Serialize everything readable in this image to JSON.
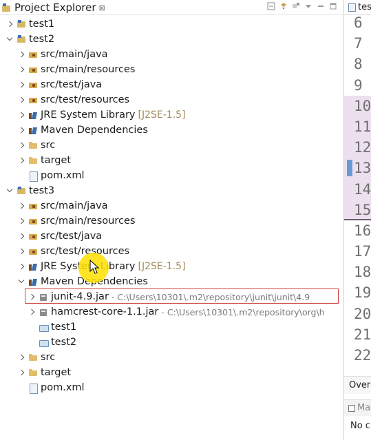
{
  "explorer": {
    "title": "Project Explorer",
    "close_glyph": "⊠",
    "toolbar_icons": [
      "collapse-all-icon",
      "link-editor-icon",
      "focus-icon",
      "view-menu-icon",
      "minimize-icon",
      "maximize-icon"
    ]
  },
  "tree": [
    {
      "level": 0,
      "expand": "right",
      "icon": "project",
      "label": "test1"
    },
    {
      "level": 0,
      "expand": "down",
      "icon": "project",
      "label": "test2"
    },
    {
      "level": 1,
      "expand": "right",
      "icon": "srcfolder",
      "label": "src/main/java"
    },
    {
      "level": 1,
      "expand": "right",
      "icon": "srcfolder",
      "label": "src/main/resources"
    },
    {
      "level": 1,
      "expand": "right",
      "icon": "srcfolder",
      "label": "src/test/java"
    },
    {
      "level": 1,
      "expand": "right",
      "icon": "srcfolder",
      "label": "src/test/resources"
    },
    {
      "level": 1,
      "expand": "right",
      "icon": "library",
      "label": "JRE System Library",
      "deco": "[J2SE-1.5]"
    },
    {
      "level": 1,
      "expand": "right",
      "icon": "library",
      "label": "Maven Dependencies"
    },
    {
      "level": 1,
      "expand": "right",
      "icon": "folder",
      "label": "src"
    },
    {
      "level": 1,
      "expand": "right",
      "icon": "folder",
      "label": "target"
    },
    {
      "level": 1,
      "expand": "none",
      "icon": "xml",
      "label": "pom.xml"
    },
    {
      "level": 0,
      "expand": "down",
      "icon": "project",
      "label": "test3"
    },
    {
      "level": 1,
      "expand": "right",
      "icon": "srcfolder",
      "label": "src/main/java"
    },
    {
      "level": 1,
      "expand": "right",
      "icon": "srcfolder",
      "label": "src/main/resources"
    },
    {
      "level": 1,
      "expand": "right",
      "icon": "srcfolder",
      "label": "src/test/java"
    },
    {
      "level": 1,
      "expand": "right",
      "icon": "srcfolder",
      "label": "src/test/resources"
    },
    {
      "level": 1,
      "expand": "right",
      "icon": "library",
      "label": "JRE System Library",
      "deco": "[J2SE-1.5]"
    },
    {
      "level": 1,
      "expand": "down",
      "icon": "library",
      "label": "Maven Dependencies"
    },
    {
      "level": 2,
      "expand": "right",
      "icon": "jar",
      "label": "junit-4.9.jar",
      "path": "- C:\\Users\\10301\\.m2\\repository\\junit\\junit\\4.9",
      "selected": true
    },
    {
      "level": 2,
      "expand": "right",
      "icon": "jar",
      "label": "hamcrest-core-1.1.jar",
      "path": "- C:\\Users\\10301\\.m2\\repository\\org\\h"
    },
    {
      "level": 2,
      "expand": "none",
      "icon": "folder-blue",
      "label": "test1"
    },
    {
      "level": 2,
      "expand": "none",
      "icon": "folder-blue",
      "label": "test2"
    },
    {
      "level": 1,
      "expand": "right",
      "icon": "folder",
      "label": "src"
    },
    {
      "level": 1,
      "expand": "right",
      "icon": "folder",
      "label": "target"
    },
    {
      "level": 1,
      "expand": "none",
      "icon": "xml",
      "label": "pom.xml"
    }
  ],
  "editor": {
    "tab_label": "tes",
    "line_numbers": [
      "6",
      "7",
      "8",
      "9",
      "10",
      "11",
      "12",
      "13",
      "14",
      "15",
      "16",
      "17",
      "18",
      "19",
      "20",
      "21",
      "22"
    ],
    "highlighted_lines": [
      "10",
      "11",
      "12",
      "13",
      "14",
      "15"
    ],
    "marker_line": "13",
    "overview_label": "Over",
    "bottom_tab_label": "Ma",
    "bottom_text": "No c"
  },
  "colors": {
    "selection_border": "#d03a3a",
    "highlight_bg": "#ece0ee",
    "cursor_highlight": "#ffe000",
    "decoration_text": "#a08b5a"
  }
}
